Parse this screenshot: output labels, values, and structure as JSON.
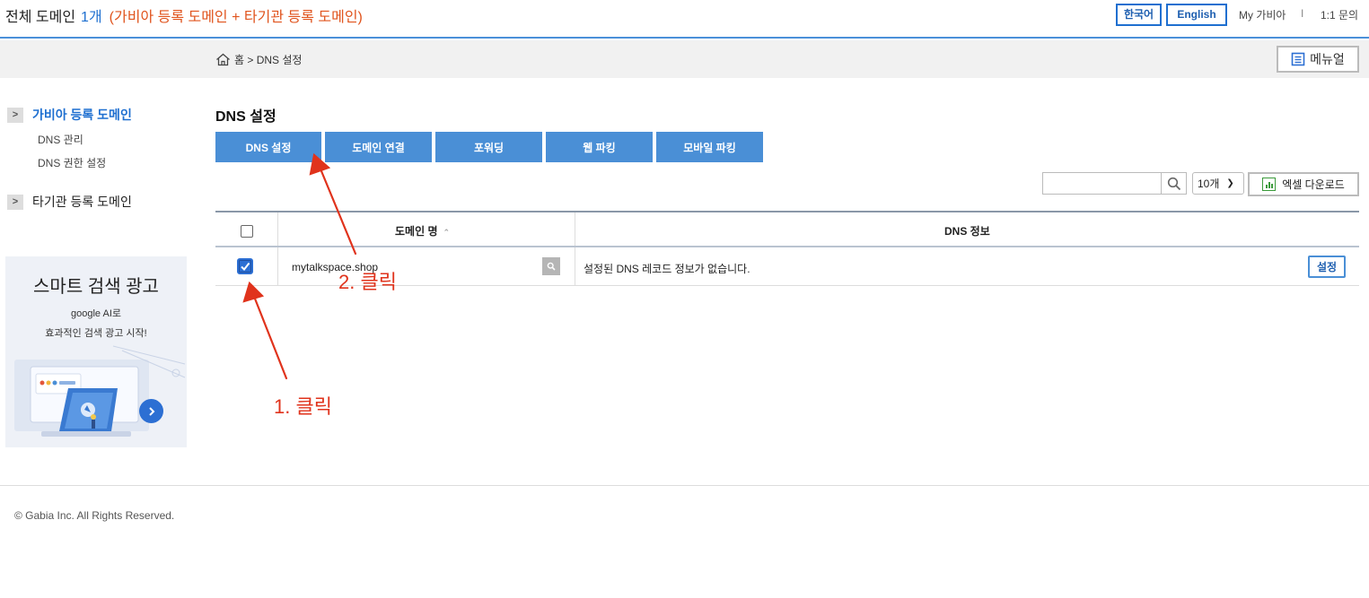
{
  "header": {
    "title": "전체 도메인",
    "count": "1개",
    "description": "(가비아 등록 도메인 + 타기관 등록 도메인)",
    "lang_korean": "한국어",
    "lang_english": "English",
    "my_link": "My 가비아",
    "separator": "I",
    "inquiry_link": "1:1 문의"
  },
  "breadcrumb": {
    "icon": "home-icon",
    "text": "홈 > DNS 설정"
  },
  "manual_button": {
    "label": "메뉴얼",
    "icon": "document-icon"
  },
  "sidebar": {
    "groups": [
      {
        "label": "가비아 등록 도메인",
        "active": true,
        "items": [
          "DNS 관리",
          "DNS 권한 설정"
        ]
      },
      {
        "label": "타기관 등록 도메인",
        "active": false,
        "items": []
      }
    ]
  },
  "ad": {
    "title": "스마트 검색 광고",
    "line1": "google AI로",
    "line2": "효과적인 검색 광고 시작!"
  },
  "main": {
    "title": "DNS 설정",
    "tabs": [
      "DNS 설정",
      "도메인 연결",
      "포워딩",
      "웹 파킹",
      "모바일 파킹"
    ],
    "search": {
      "value": "",
      "placeholder": ""
    },
    "page_size": "10개",
    "excel_button": "엑셀 다운로드",
    "table": {
      "headers": [
        "도메인 명",
        "DNS 정보"
      ],
      "sort_indicator": "^",
      "rows": [
        {
          "checked": true,
          "domain": "mytalkspace.shop",
          "dns_info": "설정된 DNS 레코드 정보가 없습니다.",
          "action": "설정"
        }
      ]
    }
  },
  "annotations": {
    "step1": "1. 클릭",
    "step2": "2. 클릭",
    "color": "#e0331c"
  },
  "footer": {
    "copyright": "© Gabia Inc. All Rights Reserved."
  },
  "colors": {
    "accent": "#4a8fd6",
    "brand_blue": "#1e6fd0",
    "highlight_orange": "#e0531c"
  }
}
